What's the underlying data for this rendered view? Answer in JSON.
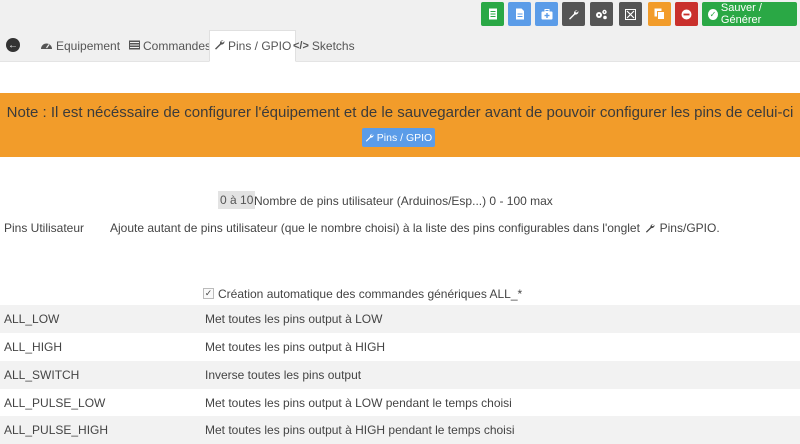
{
  "toolbar": {
    "buttons": [
      {
        "icon": "document-icon",
        "color": "#2aa845"
      },
      {
        "icon": "file-icon",
        "color": "#5b9ce8"
      },
      {
        "icon": "medkit-icon",
        "color": "#5b9ce8"
      },
      {
        "icon": "wrench-icon",
        "color": "#555555"
      },
      {
        "icon": "gears-icon",
        "color": "#555555"
      },
      {
        "icon": "expand-icon",
        "color": "#555555"
      },
      {
        "icon": "copy-icon",
        "color": "#f29c2a"
      },
      {
        "icon": "minus-circle-icon",
        "color": "#c9302c"
      }
    ],
    "save_label": "Sauver / Générer"
  },
  "tabs": [
    {
      "label": "Equipement",
      "icon": "dashboard-icon"
    },
    {
      "label": "Commandes",
      "icon": "list-icon"
    },
    {
      "label": "Pins / GPIO",
      "icon": "wrench-icon"
    },
    {
      "label": "Sketchs",
      "icon": "code-icon"
    }
  ],
  "note": {
    "text": "Note : Il est nécéssaire de configurer l'équipement et de le sauvegarder avant de pouvoir configurer les pins de celui-ci",
    "button_label": "Pins / GPIO"
  },
  "user_pins": {
    "value": "0 à 10",
    "range_label": "Nombre de pins utilisateur (Arduinos/Esp...) 0 - 100 max",
    "label": "Pins Utilisateur",
    "help": "Ajoute autant de pins utilisateur (que le nombre choisi) à la liste des pins configurables dans l'onglet",
    "help_link": "Pins/GPIO."
  },
  "auto_commands": {
    "checked": true,
    "label": "Création automatique des commandes génériques ALL_*"
  },
  "commands": [
    {
      "name": "ALL_LOW",
      "description": "Met toutes les pins output à LOW"
    },
    {
      "name": "ALL_HIGH",
      "description": "Met toutes les pins output à HIGH"
    },
    {
      "name": "ALL_SWITCH",
      "description": "Inverse toutes les pins output"
    },
    {
      "name": "ALL_PULSE_LOW",
      "description": "Met toutes les pins output à LOW pendant le temps choisi"
    },
    {
      "name": "ALL_PULSE_HIGH",
      "description": "Met toutes les pins output à HIGH pendant le temps choisi"
    }
  ]
}
